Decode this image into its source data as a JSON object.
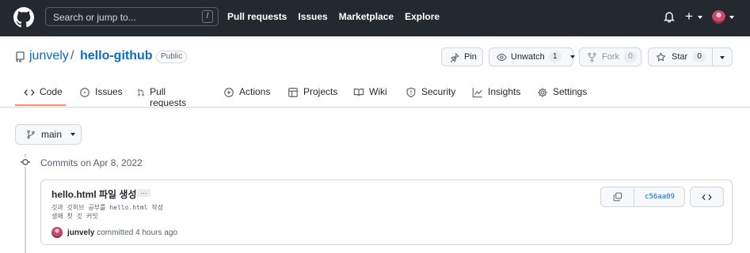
{
  "header": {
    "search_placeholder": "Search or jump to...",
    "search_hotkey": "/",
    "nav": [
      "Pull requests",
      "Issues",
      "Marketplace",
      "Explore"
    ],
    "new_label": "+"
  },
  "repo": {
    "owner": "junvely",
    "separator": "/",
    "name": "hello-github",
    "visibility": "Public",
    "actions": {
      "pin": "Pin",
      "unwatch": "Unwatch",
      "watch_count": "1",
      "fork": "Fork",
      "fork_count": "0",
      "star": "Star",
      "star_count": "0"
    }
  },
  "tabs": [
    {
      "label": "Code",
      "icon": "code-icon",
      "selected": true
    },
    {
      "label": "Issues",
      "icon": "issue-icon"
    },
    {
      "label": "Pull requests",
      "icon": "pull-request-icon"
    },
    {
      "label": "Actions",
      "icon": "play-icon"
    },
    {
      "label": "Projects",
      "icon": "table-icon"
    },
    {
      "label": "Wiki",
      "icon": "book-icon"
    },
    {
      "label": "Security",
      "icon": "shield-icon"
    },
    {
      "label": "Insights",
      "icon": "graph-icon"
    },
    {
      "label": "Settings",
      "icon": "gear-icon"
    }
  ],
  "branch": {
    "name": "main"
  },
  "commits": {
    "date_heading": "Commits on Apr 8, 2022",
    "items": [
      {
        "title": "hello.html 파일 생성",
        "ellipsis": "…",
        "body": "깃과 깃허브 공부를 hello.html 작성\n생애 첫 깃 커밋",
        "author": "junvely",
        "meta": "committed 4 hours ago",
        "sha": "c56aa09",
        "browse_label": "<>"
      }
    ]
  },
  "colors": {
    "header_bg": "#24292f",
    "link": "#0969da",
    "selected_underline": "#fd8c73",
    "border": "#d0d7de"
  }
}
